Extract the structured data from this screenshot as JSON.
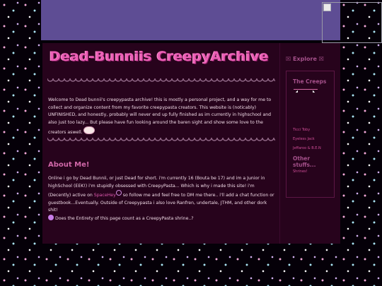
{
  "site": {
    "title": "Dead-Bunniis CreepyArchive"
  },
  "intro": {
    "text": "Welcome to Dead bunnii's creepypasta archive! this is mostly a personal project, and a way for me to collect and organize content from my favorite creepypasta creators. This website is (noticably) UNFINISHED, and honestly, probably will never end up fully finished as im currently in highschool and also just too lazy... But please have fun looking around the baren sight and show some love to the creators aswell."
  },
  "about": {
    "heading": "About Me!",
    "text_before_link": "Online i go by Dead Bunnii, or just Dead for short. i'm currently 16 (Bouta be 17) and im a Junior in highSchool (EEK!) i'm stupidly obsessed with CreepyPasta... Which is why i made this site! i'm (Decently) active on ",
    "link_label": "SpaceHey",
    "text_after_link": " so follow me and feel free to DM me there.. i'll add a chat function or guestbook...Eventually. Outside of Creepypasta i also love Ranfren, undertale, JTHM, and other dork shit!",
    "text_end": "Does the Entirety of this page count as a CreepyPasta shrine..?"
  },
  "sidebar": {
    "explore_title": "☒ Explore ☒",
    "creeps_heading": "The Creeps",
    "creeps_links": [
      "Ticci Toby",
      "Eyeless Jack",
      "Jeffaroo & B.E.N"
    ],
    "other_heading": "Other stuffs...",
    "other_links": [
      "Shrines!"
    ]
  }
}
